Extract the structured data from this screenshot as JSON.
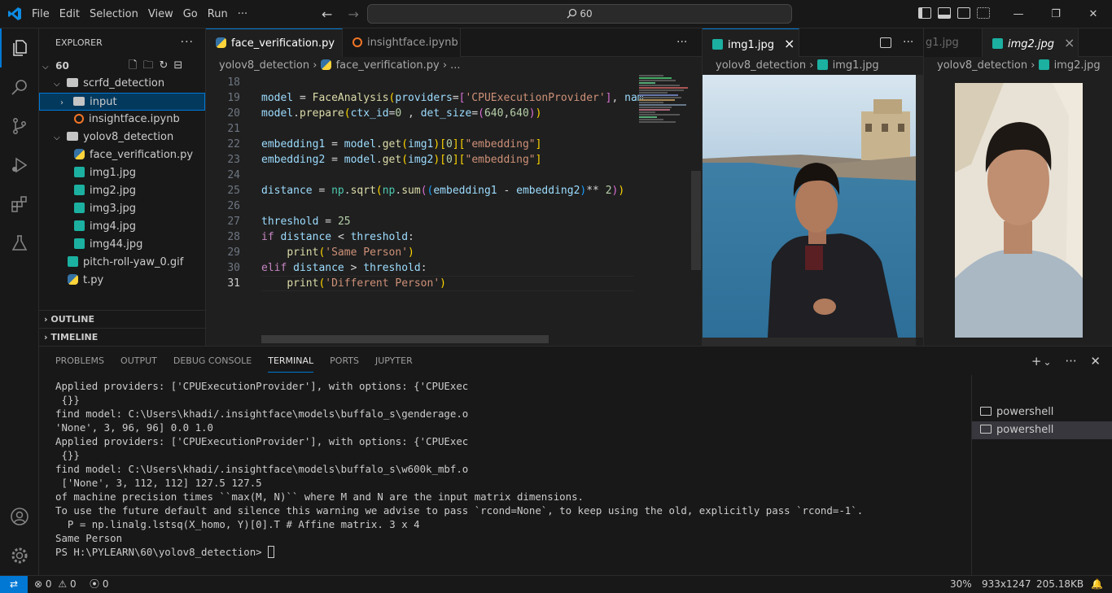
{
  "titlebar": {
    "menu": [
      "File",
      "Edit",
      "Selection",
      "View",
      "Go",
      "Run",
      "···"
    ],
    "search": "60",
    "nav_back": "←",
    "nav_forward": "→",
    "win_minimize": "—",
    "win_restore": "❐",
    "win_close": "✕"
  },
  "sidebar": {
    "title": "EXPLORER",
    "more": "···",
    "root": "60",
    "items": [
      {
        "label": "scrfd_detection"
      },
      {
        "label": "input"
      },
      {
        "label": "insightface.ipynb"
      },
      {
        "label": "yolov8_detection"
      },
      {
        "label": "face_verification.py"
      },
      {
        "label": "img1.jpg"
      },
      {
        "label": "img2.jpg"
      },
      {
        "label": "img3.jpg"
      },
      {
        "label": "img4.jpg"
      },
      {
        "label": "img44.jpg"
      },
      {
        "label": "pitch-roll-yaw_0.gif"
      },
      {
        "label": "t.py"
      }
    ],
    "outline": "OUTLINE",
    "timeline": "TIMELINE"
  },
  "editor1": {
    "tabs": [
      {
        "label": "face_verification.py",
        "close": "×"
      },
      {
        "label": "insightface.ipynb"
      }
    ],
    "more": "···",
    "breadcrumb": {
      "folder": "yolov8_detection",
      "file": "face_verification.py",
      "tail": "..."
    },
    "line_numbers": [
      "18",
      "19",
      "20",
      "21",
      "22",
      "23",
      "24",
      "25",
      "26",
      "27",
      "28",
      "29",
      "30",
      "31"
    ],
    "current_line": "31"
  },
  "editor2": {
    "tab": "img1.jpg",
    "close": "×",
    "breadcrumb": {
      "folder": "yolov8_detection",
      "file": "img1.jpg"
    }
  },
  "editor3": {
    "tab_partial": "g1.jpg",
    "tab": "img2.jpg",
    "close": "×",
    "breadcrumb": {
      "folder": "yolov8_detection",
      "file": "img2.jpg"
    }
  },
  "panel": {
    "tabs": [
      "PROBLEMS",
      "OUTPUT",
      "DEBUG CONSOLE",
      "TERMINAL",
      "PORTS",
      "JUPYTER"
    ],
    "active_tab": "TERMINAL",
    "actions": {
      "add": "+",
      "dropdown": "⌄",
      "more": "···",
      "close": "✕"
    },
    "terminal_lines": [
      "Applied providers: ['CPUExecutionProvider'], with options: {'CPUExec",
      " {}}",
      "find model: C:\\Users\\khadi/.insightface\\models\\buffalo_s\\genderage.o",
      "'None', 3, 96, 96] 0.0 1.0",
      "Applied providers: ['CPUExecutionProvider'], with options: {'CPUExec",
      " {}}",
      "find model: C:\\Users\\khadi/.insightface\\models\\buffalo_s\\w600k_mbf.o",
      " ['None', 3, 112, 112] 127.5 127.5",
      "of machine precision times ``max(M, N)`` where M and N are the input matrix dimensions.",
      "To use the future default and silence this warning we advise to pass `rcond=None`, to keep using the old, explicitly pass `rcond=-1`.",
      "  P = np.linalg.lstsq(X_homo, Y)[0].T # Affine matrix. 3 x 4",
      "Same Person",
      "PS H:\\PYLEARN\\60\\yolov8_detection> "
    ],
    "terminals": [
      "powershell",
      "powershell"
    ]
  },
  "statusbar": {
    "errors": "0",
    "warnings": "0",
    "ports": "0",
    "zoom": "30%",
    "dimensions": "933x1247",
    "size": "205.18KB"
  },
  "colors": {
    "accent": "#0078d4",
    "bg": "#1f1f1f",
    "sidebar_bg": "#181818"
  }
}
